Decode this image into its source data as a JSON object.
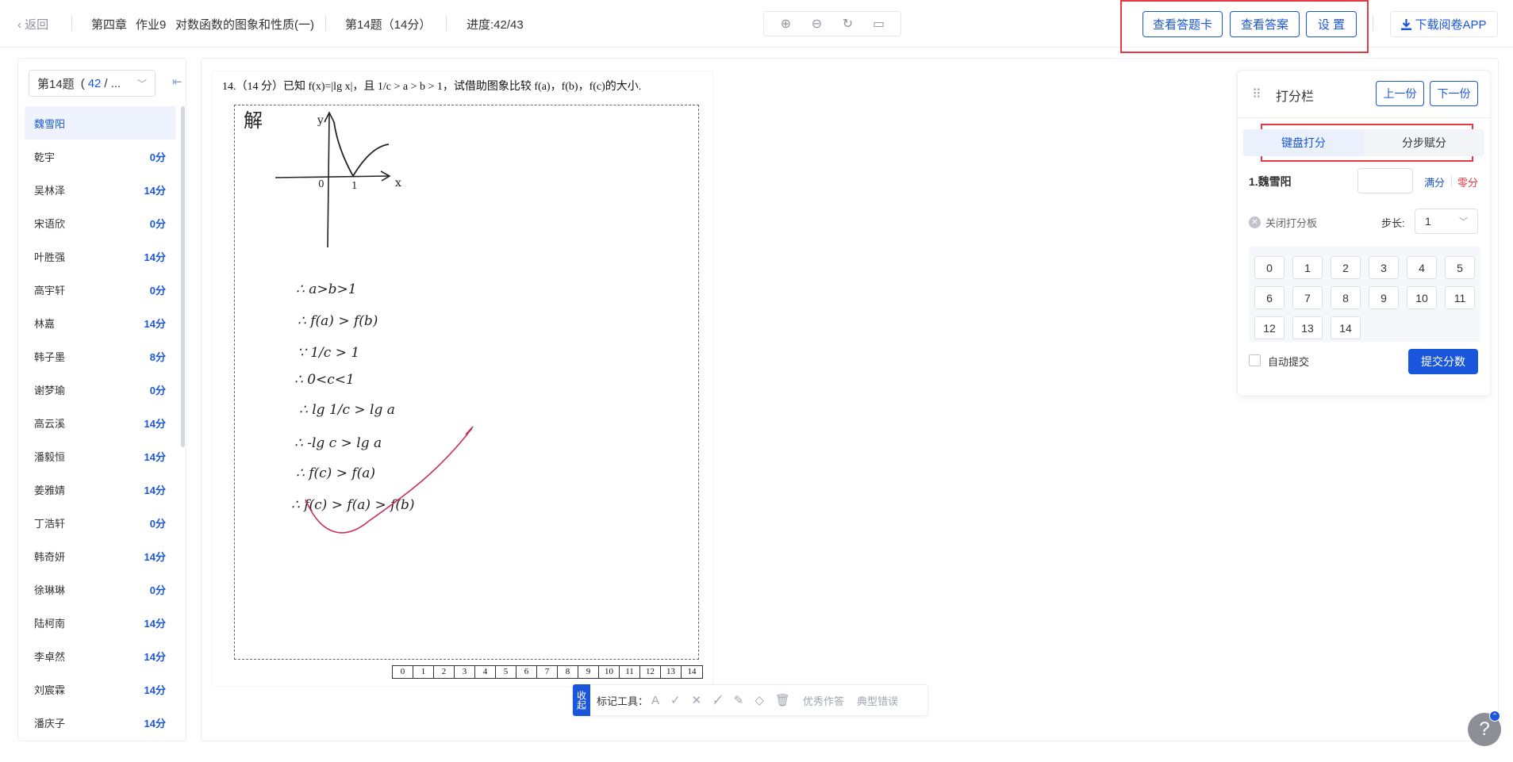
{
  "topbar": {
    "back": "返回",
    "chapter": "第四章",
    "assignment": "作业9",
    "lesson": "对数函数的图象和性质(一)",
    "question": "第14题（14分）",
    "progress": "进度:42/43",
    "view_card": "查看答题卡",
    "view_answer": "查看答案",
    "settings": "设 置",
    "download_app": "下载阅卷APP"
  },
  "sidebar": {
    "question_label": "第14题",
    "count_current": "42",
    "count_rest": "/ ...",
    "students": [
      {
        "name": "魏雪阳",
        "score": ""
      },
      {
        "name": "乾宇",
        "score": "0分"
      },
      {
        "name": "吴林泽",
        "score": "14分"
      },
      {
        "name": "宋语欣",
        "score": "0分"
      },
      {
        "name": "叶胜强",
        "score": "14分"
      },
      {
        "name": "高宇轩",
        "score": "0分"
      },
      {
        "name": "林嘉",
        "score": "14分"
      },
      {
        "name": "韩子墨",
        "score": "8分"
      },
      {
        "name": "谢梦瑜",
        "score": "0分"
      },
      {
        "name": "高云溪",
        "score": "14分"
      },
      {
        "name": "潘毅恒",
        "score": "14分"
      },
      {
        "name": "姜雅婧",
        "score": "14分"
      },
      {
        "name": "丁浩轩",
        "score": "0分"
      },
      {
        "name": "韩奇妍",
        "score": "14分"
      },
      {
        "name": "徐琳琳",
        "score": "0分"
      },
      {
        "name": "陆柯南",
        "score": "14分"
      },
      {
        "name": "李卓然",
        "score": "14分"
      },
      {
        "name": "刘宸霖",
        "score": "14分"
      },
      {
        "name": "潘庆子",
        "score": "14分"
      }
    ]
  },
  "paper": {
    "question_text": "14.（14 分）已知 f(x)=|lg x|，且 1/c > a > b > 1，试借助图象比较 f(a)，f(b)，f(c)的大小.",
    "score_strip": [
      "0",
      "1",
      "2",
      "3",
      "4",
      "5",
      "6",
      "7",
      "8",
      "9",
      "10",
      "11",
      "12",
      "13",
      "14"
    ],
    "handwriting": {
      "solution_mark": "解",
      "axis_y": "y",
      "axis_x": "x",
      "origin": "0",
      "one": "1",
      "lines": [
        "∴ a>b>1",
        "∴ f(a) > f(b)",
        "∵ 1/c > 1",
        "∴ 0<c<1",
        "∴ lg 1/c > lg a",
        "∴ -lg c > lg a",
        "∴ f(c) > f(a)",
        "∴ f(c) > f(a) > f(b)"
      ]
    }
  },
  "marktools": {
    "collapse": "收起",
    "label": "标记工具：",
    "excellent": "优秀作答",
    "typical_error": "典型错误"
  },
  "scoring": {
    "title": "打分栏",
    "prev": "上一份",
    "next": "下一份",
    "tab_keyboard": "键盘打分",
    "tab_step": "分步赋分",
    "student": "1.魏雪阳",
    "score_value": "",
    "full": "满分",
    "zero": "零分",
    "close_pad": "关闭打分板",
    "step_label": "步长:",
    "step_value": "1",
    "keys": [
      "0",
      "1",
      "2",
      "3",
      "4",
      "5",
      "6",
      "7",
      "8",
      "9",
      "10",
      "11",
      "12",
      "13",
      "14"
    ],
    "auto_submit": "自动提交",
    "submit": "提交分数"
  },
  "help": "?",
  "colors": {
    "primary": "#1a56db",
    "highlight_box": "#e53945",
    "pen_red": "#c8315a"
  }
}
